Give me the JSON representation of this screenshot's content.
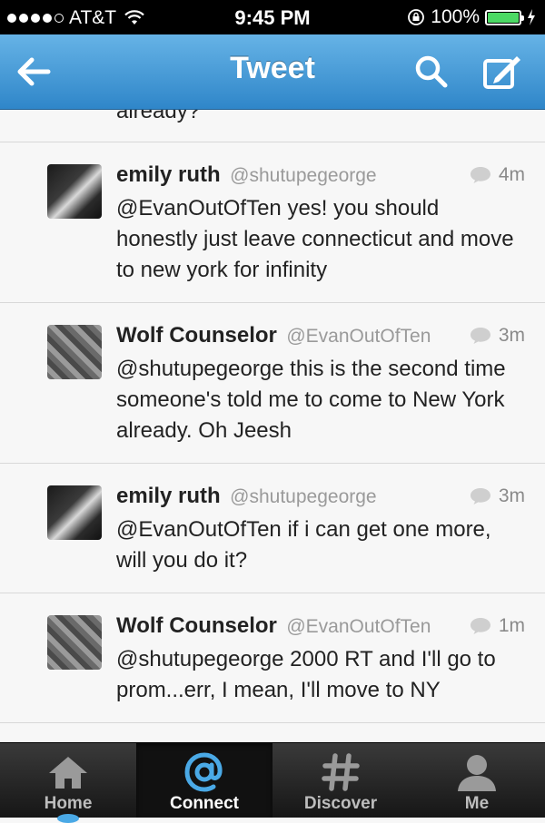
{
  "status_bar": {
    "carrier": "AT&T",
    "time": "9:45 PM",
    "battery": "100%",
    "battery_level": 1.0,
    "signal_bars_filled": 4,
    "signal_bars_total": 5
  },
  "nav": {
    "title": "Tweet",
    "back_icon": "back-arrow-icon",
    "search_icon": "search-icon",
    "compose_icon": "compose-icon"
  },
  "timeline": {
    "partial_text": "already?",
    "tweets": [
      {
        "name": "emily ruth",
        "handle": "@shutupegeorge",
        "time": "4m",
        "text": "@EvanOutOfTen yes! you should honestly just leave connecticut and move to new york for infinity"
      },
      {
        "name": "Wolf Counselor",
        "handle": "@EvanOutOfTen",
        "time": "3m",
        "text": "@shutupegeorge this is the second time someone's told me to come to New York already. Oh Jeesh"
      },
      {
        "name": "emily ruth",
        "handle": "@shutupegeorge",
        "time": "3m",
        "text": "@EvanOutOfTen if i can get one more, will you do it?"
      },
      {
        "name": "Wolf Counselor",
        "handle": "@EvanOutOfTen",
        "time": "1m",
        "text": "@shutupegeorge 2000 RT and I'll go to prom...err, I mean, I'll move to NY"
      }
    ]
  },
  "tab_bar": {
    "tabs": [
      {
        "label": "Home",
        "icon": "home-icon",
        "active": false
      },
      {
        "label": "Connect",
        "icon": "at-sign-icon",
        "active": true
      },
      {
        "label": "Discover",
        "icon": "hashtag-icon",
        "active": false
      },
      {
        "label": "Me",
        "icon": "person-icon",
        "active": false
      }
    ]
  },
  "colors": {
    "nav_blue": "#2f86c9",
    "battery_green": "#4cd964",
    "connect_blue": "#4aa9e6"
  }
}
